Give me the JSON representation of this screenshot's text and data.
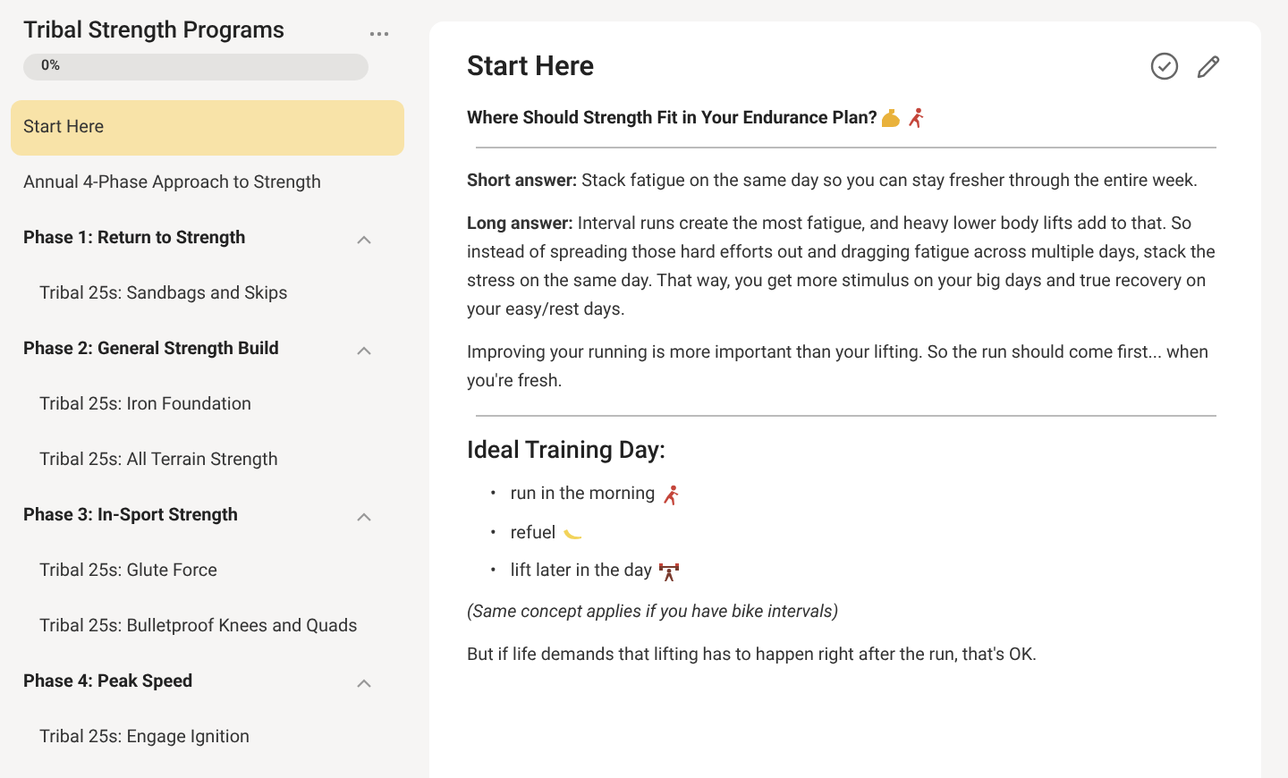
{
  "sidebar": {
    "title": "Tribal Strength Programs",
    "progress": {
      "label": "0%",
      "level": 0
    },
    "items": [
      {
        "kind": "link",
        "label": "Start Here",
        "selected": true
      },
      {
        "kind": "link",
        "label": "Annual 4-Phase Approach to Strength",
        "selected": false
      },
      {
        "kind": "phase",
        "label": "Phase 1: Return to Strength",
        "selected": false,
        "expanded": true,
        "children": [
          {
            "label": "Tribal 25s: Sandbags and Skips",
            "selected": false
          }
        ]
      },
      {
        "kind": "phase",
        "label": "Phase 2: General Strength Build",
        "selected": false,
        "expanded": true,
        "children": [
          {
            "label": "Tribal 25s: Iron Foundation",
            "selected": false
          },
          {
            "label": "Tribal 25s: All Terrain Strength",
            "selected": false
          }
        ]
      },
      {
        "kind": "phase",
        "label": "Phase 3: In-Sport Strength",
        "selected": false,
        "expanded": true,
        "children": [
          {
            "label": "Tribal 25s: Glute Force",
            "selected": false
          },
          {
            "label": "Tribal 25s: Bulletproof Knees and Quads",
            "selected": false
          }
        ]
      },
      {
        "kind": "phase",
        "label": "Phase 4: Peak Speed",
        "selected": false,
        "expanded": true,
        "children": [
          {
            "label": "Tribal 25s: Engage Ignition",
            "selected": false
          }
        ]
      }
    ]
  },
  "lesson": {
    "title": "Start Here",
    "blocks": [
      {
        "kind": "lead",
        "text": "Where Should Strength Fit in Your Endurance Plan?"
      },
      {
        "kind": "rule"
      },
      {
        "kind": "para",
        "text": "**Short answer:** Stack fatigue on the same day so you can stay fresher through the entire week."
      },
      {
        "kind": "para",
        "text": "**Long answer:** Interval runs create the most fatigue, and heavy lower body lifts add to that. So instead of spreading those hard efforts out and dragging fatigue across multiple days, stack the stress on the same day. That way, you get more stimulus on your big days and true recovery on your easy/rest days."
      },
      {
        "kind": "para",
        "text": "Improving your running is more important than your lifting. So the run should come first... when you're fresh."
      },
      {
        "kind": "rule"
      },
      {
        "kind": "heading",
        "text": "Ideal Training Day:"
      },
      {
        "kind": "bullets",
        "items": [
          {
            "marker": "•",
            "text": "run in the morning"
          },
          {
            "marker": "•",
            "text": "refuel"
          },
          {
            "marker": "•",
            "text": "lift later in the day"
          }
        ]
      },
      {
        "kind": "note",
        "text": "(Same concept applies if you have bike intervals)"
      },
      {
        "kind": "para",
        "text": "But if life demands that lifting has to happen right after the run, that's OK."
      }
    ]
  }
}
